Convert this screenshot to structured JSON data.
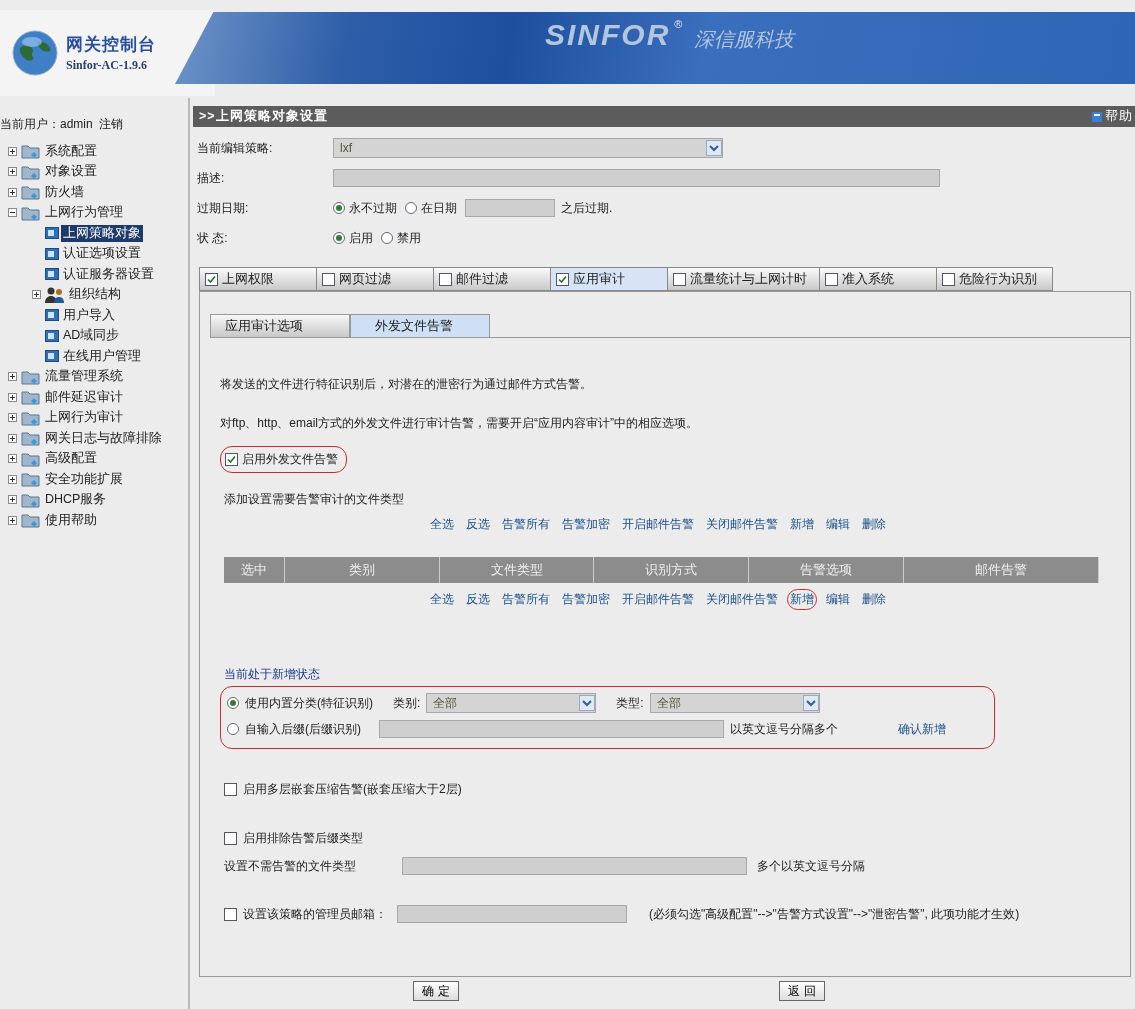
{
  "header": {
    "title": "网关控制台",
    "version": "Sinfor-AC-1.9.6",
    "brand": "SINFOR",
    "registered": "®",
    "brand_cn": "深信服科技"
  },
  "sidebar": {
    "user_label": "当前用户：admin",
    "logout": "注销",
    "tree": [
      {
        "kind": "folder",
        "label": "系统配置",
        "expanded": false,
        "selected": false
      },
      {
        "kind": "folder",
        "label": "对象设置",
        "expanded": false,
        "selected": false
      },
      {
        "kind": "folder",
        "label": "防火墙",
        "expanded": false,
        "selected": false
      },
      {
        "kind": "folder",
        "label": "上网行为管理",
        "expanded": true,
        "selected": false,
        "children": [
          {
            "kind": "page",
            "label": "上网策略对象",
            "selected": true
          },
          {
            "kind": "page",
            "label": "认证选项设置",
            "selected": false
          },
          {
            "kind": "page",
            "label": "认证服务器设置",
            "selected": false
          },
          {
            "kind": "people",
            "label": "组织结构",
            "expanded": false,
            "selected": false
          },
          {
            "kind": "page",
            "label": "用户导入",
            "selected": false
          },
          {
            "kind": "page",
            "label": "AD域同步",
            "selected": false
          },
          {
            "kind": "page",
            "label": "在线用户管理",
            "selected": false
          }
        ]
      },
      {
        "kind": "folder",
        "label": "流量管理系统",
        "expanded": false,
        "selected": false
      },
      {
        "kind": "folder",
        "label": "邮件延迟审计",
        "expanded": false,
        "selected": false
      },
      {
        "kind": "folder",
        "label": "上网行为审计",
        "expanded": false,
        "selected": false
      },
      {
        "kind": "folder",
        "label": "网关日志与故障排除",
        "expanded": false,
        "selected": false
      },
      {
        "kind": "folder",
        "label": "高级配置",
        "expanded": false,
        "selected": false
      },
      {
        "kind": "folder",
        "label": "安全功能扩展",
        "expanded": false,
        "selected": false
      },
      {
        "kind": "folder",
        "label": "DHCP服务",
        "expanded": false,
        "selected": false
      },
      {
        "kind": "folder",
        "label": "使用帮助",
        "expanded": false,
        "selected": false
      }
    ]
  },
  "panel": {
    "title": ">>上网策略对象设置",
    "help": "帮助"
  },
  "form": {
    "policy": {
      "label": "当前编辑策略:",
      "value": "lxf"
    },
    "description": {
      "label": "描述:"
    },
    "expiry": {
      "label": "过期日期:",
      "options": [
        {
          "label": "永不过期",
          "selected": true
        },
        {
          "label": "在日期",
          "selected": false
        }
      ],
      "suffix": "之后过期."
    },
    "status": {
      "label": "状 态:",
      "options": [
        {
          "label": "启用",
          "selected": true
        },
        {
          "label": "禁用",
          "selected": false
        }
      ]
    }
  },
  "tabs": [
    {
      "label": "上网权限",
      "checked": true,
      "selected": false
    },
    {
      "label": "网页过滤",
      "checked": false,
      "selected": false
    },
    {
      "label": "邮件过滤",
      "checked": false,
      "selected": false
    },
    {
      "label": "应用审计",
      "checked": true,
      "selected": true
    },
    {
      "label": "流量统计与上网计时",
      "checked": false,
      "selected": false
    },
    {
      "label": "准入系统",
      "checked": false,
      "selected": false
    },
    {
      "label": "危险行为识别",
      "checked": false,
      "selected": false
    }
  ],
  "subtabs": [
    {
      "label": "应用审计选项",
      "selected": false
    },
    {
      "label": "外发文件告警",
      "selected": true
    }
  ],
  "content": {
    "paragraphs": [
      "将发送的文件进行特征识别后，对潜在的泄密行为通过邮件方式告警。",
      "对ftp、http、email方式的外发文件进行审计告警，需要开启“应用内容审计”中的相应选项。"
    ],
    "enable": {
      "label": "启用外发文件告警",
      "checked": true,
      "highlighted": true
    },
    "file_types_title": "添加设置需要告警审计的文件类型",
    "actions_top": [
      {
        "label": "全选",
        "highlighted": false
      },
      {
        "label": "反选",
        "highlighted": false
      },
      {
        "label": "告警所有",
        "highlighted": false
      },
      {
        "label": "告警加密",
        "highlighted": false
      },
      {
        "label": "开启邮件告警",
        "highlighted": false
      },
      {
        "label": "关闭邮件告警",
        "highlighted": false
      },
      {
        "label": "新增",
        "highlighted": false
      },
      {
        "label": "编辑",
        "highlighted": false
      },
      {
        "label": "删除",
        "highlighted": false
      }
    ],
    "table": {
      "columns": [
        "选中",
        "类别",
        "文件类型",
        "识别方式",
        "告警选项",
        "邮件告警"
      ]
    },
    "actions_bottom": [
      {
        "label": "全选",
        "highlighted": false
      },
      {
        "label": "反选",
        "highlighted": false
      },
      {
        "label": "告警所有",
        "highlighted": false
      },
      {
        "label": "告警加密",
        "highlighted": false
      },
      {
        "label": "开启邮件告警",
        "highlighted": false
      },
      {
        "label": "关闭邮件告警",
        "highlighted": false
      },
      {
        "label": "新增",
        "highlighted": true
      },
      {
        "label": "编辑",
        "highlighted": false
      },
      {
        "label": "删除",
        "highlighted": false
      }
    ],
    "add_state": {
      "title": "当前处于新增状态",
      "highlighted": true,
      "options": [
        {
          "kind": "builtin",
          "label": "使用内置分类(特征识别)",
          "selected": true,
          "category_label": "类别:",
          "category_value": "全部",
          "type_label": "类型:",
          "type_value": "全部"
        },
        {
          "kind": "suffix",
          "label": "自输入后缀(后缀识别)",
          "selected": false,
          "hint": "以英文逗号分隔多个"
        }
      ],
      "confirm": "确认新增"
    },
    "nested": {
      "label": "启用多层嵌套压缩告警(嵌套压缩大于2层)",
      "checked": false
    },
    "exclude": {
      "label": "启用排除告警后缀类型",
      "checked": false,
      "field_label": "设置不需告警的文件类型",
      "hint": "多个以英文逗号分隔"
    },
    "admin_email": {
      "label": "设置该策略的管理员邮箱：",
      "checked": false,
      "note": "(必须勾选\"高级配置\"-->\"告警方式设置\"-->\"泄密告警\", 此项功能才生效)"
    }
  },
  "buttons": [
    {
      "label": "确 定"
    },
    {
      "label": "返 回"
    }
  ]
}
